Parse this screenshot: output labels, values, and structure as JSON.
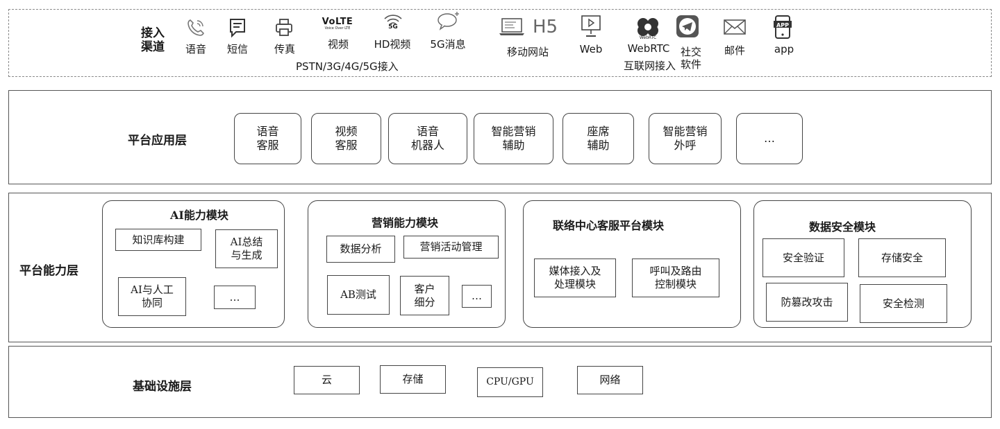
{
  "channels": {
    "title": "接入\n渠道",
    "items": [
      {
        "label": "语音",
        "icon": "phone-icon"
      },
      {
        "label": "短信",
        "icon": "sms-icon"
      },
      {
        "label": "传真",
        "icon": "fax-icon"
      },
      {
        "label": "视频",
        "icon": "volte-icon",
        "icon_text": "VoLTE",
        "icon_subtext": "Voice Over LTE"
      },
      {
        "label": "HD视频",
        "icon": "5g-signal-icon",
        "icon_text": "5G"
      },
      {
        "label": "5G消息",
        "icon": "chat-bubble-icon"
      },
      {
        "label": "移动网站",
        "icon": "laptop-h5-icon",
        "icon_text": "H5"
      },
      {
        "label": "Web",
        "icon": "monitor-icon"
      },
      {
        "label": "WebRTC",
        "icon": "webrtc-icon",
        "icon_text": "WebRTC"
      },
      {
        "label": "社交\n软件",
        "icon": "telegram-icon"
      },
      {
        "label": "邮件",
        "icon": "mail-icon"
      },
      {
        "label": "app",
        "icon": "app-icon",
        "icon_text": "APP"
      }
    ],
    "group_pstn": "PSTN/3G/4G/5G接入",
    "group_internet": "互联网接入"
  },
  "app_layer": {
    "title": "平台应用层",
    "items": [
      "语音\n客服",
      "视频\n客服",
      "语音\n机器人",
      "智能营销\n辅助",
      "座席\n辅助",
      "智能营销\n外呼",
      "…"
    ]
  },
  "capability_layer": {
    "title": "平台能力层",
    "ai": {
      "title": "AI能力模块",
      "items": [
        "知识库构建",
        "AI总结\n与生成",
        "AI与人工\n协同",
        "…"
      ]
    },
    "marketing": {
      "title": "营销能力模块",
      "items": [
        "数据分析",
        "营销活动管理",
        "AB测试",
        "客户\n细分",
        "…"
      ]
    },
    "contact": {
      "title": "联络中心客服平台模块",
      "items": [
        "媒体接入及\n处理模块",
        "呼叫及路由\n控制模块"
      ]
    },
    "security": {
      "title": "数据安全模块",
      "items": [
        "安全验证",
        "存储安全",
        "防篡改攻击",
        "安全检测"
      ]
    }
  },
  "infra_layer": {
    "title": "基础设施层",
    "items": [
      "云",
      "存储",
      "CPU/GPU",
      "网络"
    ]
  },
  "colors": {
    "border": "#444444",
    "dashed": "#888888",
    "icon": "#666666",
    "icon_dark": "#333333"
  }
}
